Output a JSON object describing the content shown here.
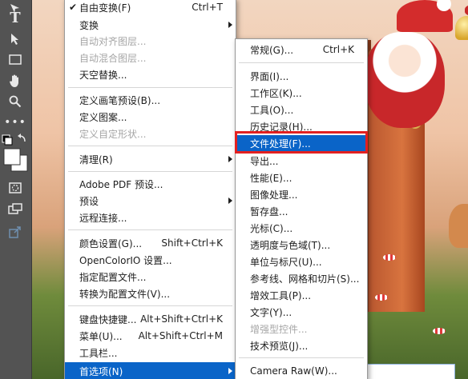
{
  "edit_menu": {
    "free_transform": "自由变换(F)",
    "free_transform_shortcut": "Ctrl+T",
    "transform": "变换",
    "auto_align_layers": "自动对齐图层...",
    "auto_blend_layers": "自动混合图层...",
    "sky_replace": "天空替换...",
    "define_brush_preset": "定义画笔预设(B)...",
    "define_pattern": "定义图案...",
    "define_custom_shape": "定义自定形状...",
    "purge": "清理(R)",
    "adobe_pdf_presets": "Adobe PDF 预设...",
    "presets": "预设",
    "remote_connections": "远程连接...",
    "color_settings": "颜色设置(G)...",
    "color_settings_shortcut": "Shift+Ctrl+K",
    "opencolorio": "OpenColorIO 设置...",
    "assign_profile": "指定配置文件...",
    "convert_to_profile": "转换为配置文件(V)...",
    "keyboard_shortcuts": "键盘快捷键...",
    "keyboard_shortcuts_shortcut": "Alt+Shift+Ctrl+K",
    "menus": "菜单(U)...",
    "menus_shortcut": "Alt+Shift+Ctrl+M",
    "toolbar": "工具栏...",
    "preferences": "首选项(N)"
  },
  "preferences_submenu": {
    "general": "常规(G)...",
    "general_shortcut": "Ctrl+K",
    "interface": "界面(I)...",
    "workspace": "工作区(K)...",
    "tools": "工具(O)...",
    "history_log": "历史记录(H)...",
    "file_handling": "文件处理(F)...",
    "export": "导出...",
    "performance": "性能(E)...",
    "image_processing": "图像处理...",
    "scratch_disks": "暂存盘...",
    "cursors": "光标(C)...",
    "transparency_gamut": "透明度与色域(T)...",
    "units_rulers": "单位与标尺(U)...",
    "guides_grid_slices": "参考线、网格和切片(S)...",
    "plugins": "增效工具(P)...",
    "type": "文字(Y)...",
    "enhanced_controls": "增强型控件...",
    "technology_previews": "技术预览(J)...",
    "camera_raw": "Camera Raw(W)..."
  },
  "toolbar_icons": [
    "move-icon",
    "type-icon",
    "path-select-icon",
    "rectangle-icon",
    "hand-icon",
    "zoom-icon",
    "more-icon",
    "color-swatch-icon",
    "quick-mask-icon",
    "screen-mode-icon",
    "share-icon"
  ],
  "colors": {
    "menu_highlight": "#0a64c8",
    "annotation_box": "#e32020",
    "toolbar_bg": "#535353"
  }
}
